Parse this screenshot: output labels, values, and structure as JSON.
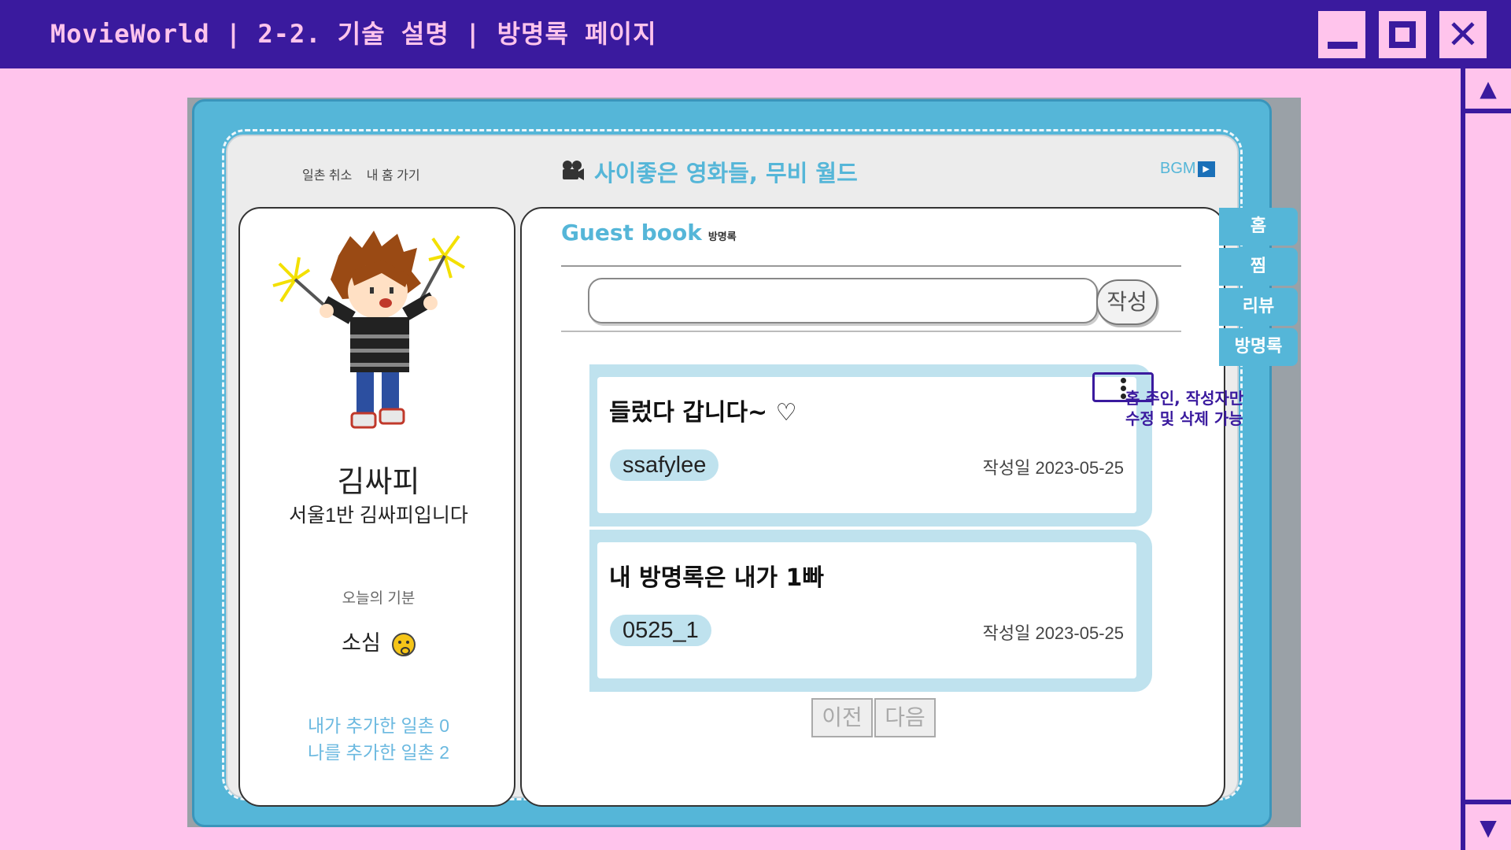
{
  "window": {
    "title": "MovieWorld | 2-2. 기술 설명 | 방명록 페이지",
    "minimize_icon": "minimize-icon",
    "maximize_icon": "maximize-icon",
    "close_label": "✕"
  },
  "scrollbar": {
    "up": "▲",
    "down": "▼"
  },
  "top_links": {
    "unfriend": "일촌 취소",
    "my_home": "내 홈 가기"
  },
  "site": {
    "title": "사이좋은 영화들, 무비 월드",
    "camera_icon": "movie-camera-icon",
    "bgm_label": "BGM",
    "bgm_icon": "▶"
  },
  "profile": {
    "name": "김싸피",
    "intro": "서울1반 김싸피입니다",
    "mood_label": "오늘의 기분",
    "mood_value": "소심",
    "mood_icon": "worried-face-icon",
    "added_by_me": "내가 추가한 일촌 0",
    "added_me": "나를 추가한 일촌 2"
  },
  "guestbook": {
    "title": "Guest book",
    "subtitle": "방명록",
    "input_value": "",
    "submit_label": "작성",
    "entries": [
      {
        "message": "들렀다 갑니다~ ♡",
        "author": "ssafylee",
        "date": "작성일 2023-05-25"
      },
      {
        "message": "내 방명록은 내가 1빠",
        "author": "0525_1",
        "date": "작성일 2023-05-25"
      }
    ],
    "prev_label": "이전",
    "next_label": "다음"
  },
  "side_tabs": [
    "홈",
    "찜",
    "리뷰",
    "방명록"
  ],
  "annotation": {
    "line1": "홈 주인, 작성자만",
    "line2": "수정 및 삭제 가능"
  },
  "colors": {
    "titlebar": "#3a1a9e",
    "background": "#ffc4ec",
    "accent": "#55b6d8",
    "entry_bg": "#bfe2ee"
  }
}
